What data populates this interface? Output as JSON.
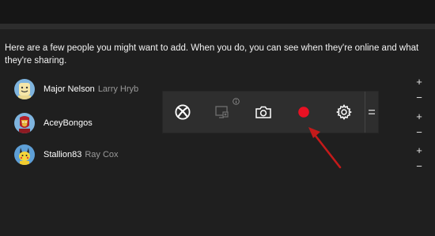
{
  "intro_text": "Here are a few people you might want to add. When you do, you can see when they're online and what they're sharing.",
  "people": [
    {
      "gamertag": "Major Nelson",
      "real_name": "Larry Hryb",
      "avatar": "smiley-avatar"
    },
    {
      "gamertag": "AceyBongos",
      "real_name": "",
      "avatar": "iron-man-avatar"
    },
    {
      "gamertag": "Stallion83",
      "real_name": "Ray Cox",
      "avatar": "pikachu-avatar"
    }
  ],
  "controls": {
    "plus": "+",
    "minus": "−"
  },
  "game_bar": {
    "buttons": [
      {
        "name": "xbox-icon"
      },
      {
        "name": "screenshot-background-record-icon"
      },
      {
        "name": "camera-icon"
      },
      {
        "name": "record-icon"
      },
      {
        "name": "gear-icon"
      }
    ],
    "info_icon": "info-icon",
    "grip_icon": "grip-icon",
    "record_color": "#e81123"
  },
  "annotation": {
    "arrow_color": "#c41a1a"
  }
}
